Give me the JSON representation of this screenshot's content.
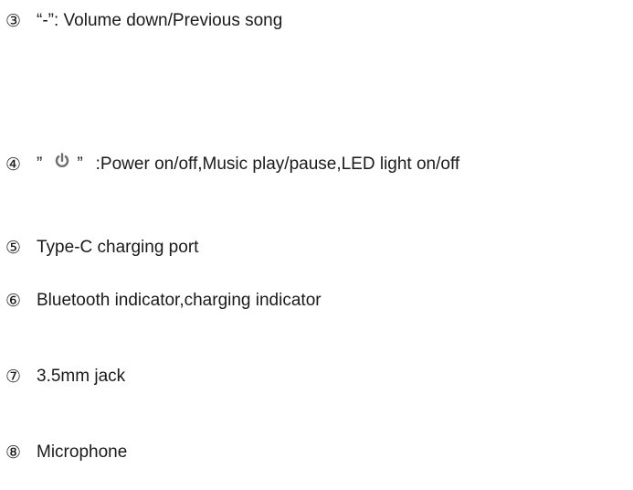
{
  "items": [
    {
      "number": "③",
      "text": "“-”: Volume down/Previous song"
    },
    {
      "number": "④",
      "prefix": "”",
      "suffix": "”",
      "text": ":Power on/off,Music play/pause,LED light on/off",
      "icon": "power-icon"
    },
    {
      "number": "⑤",
      "text": "Type-C charging port"
    },
    {
      "number": "⑥",
      "text": "Bluetooth indicator,charging indicator"
    },
    {
      "number": "⑦",
      "text": "3.5mm jack"
    },
    {
      "number": "⑧",
      "text": "Microphone"
    }
  ]
}
